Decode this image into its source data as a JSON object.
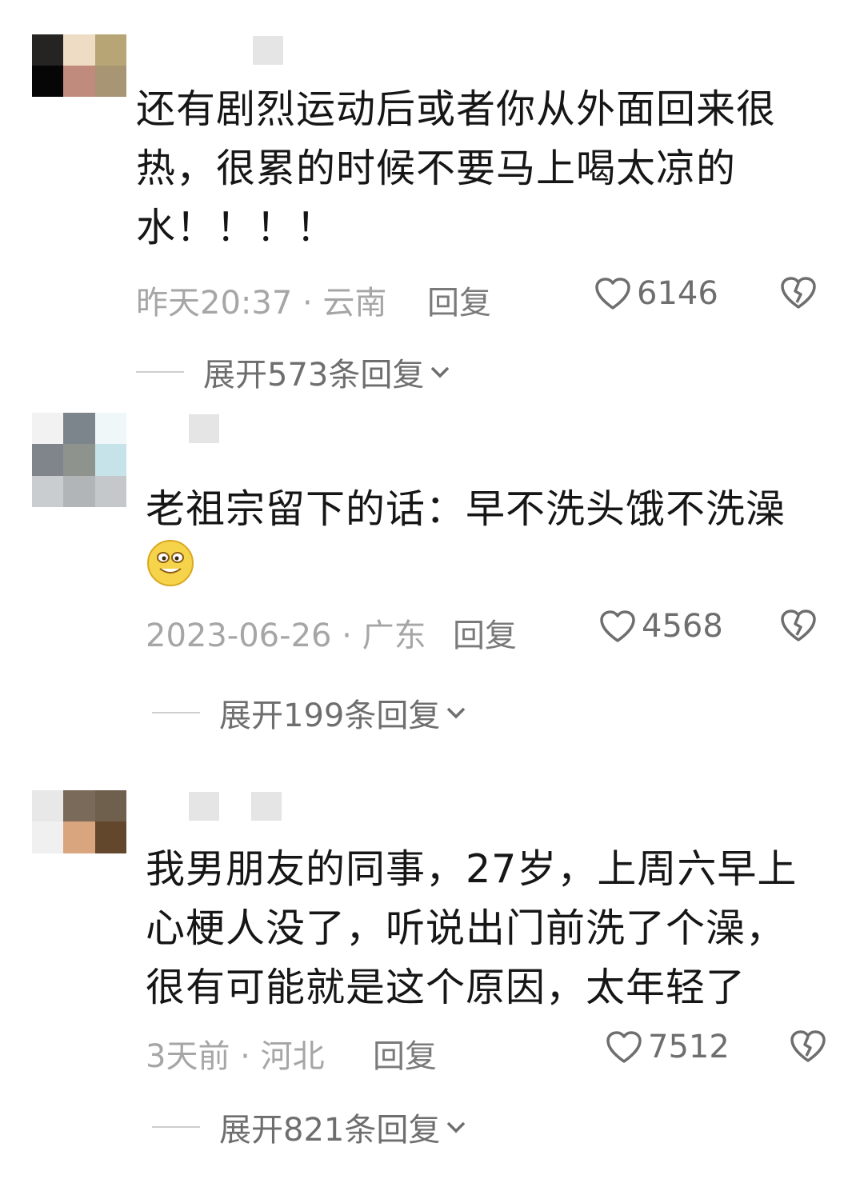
{
  "comments": [
    {
      "text_lines": [
        "还有剧烈运动后或者你从外面回来很",
        "热，很累的时候不要马上喝太凉的",
        "水！！！！"
      ],
      "time": "昨天20:37 · 云南",
      "reply_label": "回复",
      "likes": "6146",
      "expand_label": "展开573条回复"
    },
    {
      "text_lines": [
        "老祖宗留下的话：早不洗头饿不洗澡"
      ],
      "emoji": "grinning-emoji-icon",
      "time": "2023-06-26 · 广东",
      "reply_label": "回复",
      "likes": "4568",
      "expand_label": "展开199条回复"
    },
    {
      "text_lines": [
        "我男朋友的同事，27岁，上周六早上",
        "心梗人没了，听说出门前洗了个澡，",
        "很有可能就是这个原因，太年轻了"
      ],
      "time": "3天前 · 河北",
      "reply_label": "回复",
      "likes": "7512",
      "expand_label": "展开821条回复"
    }
  ],
  "icons": {
    "like": "heart-outline-icon",
    "dislike": "broken-heart-icon",
    "expand": "chevron-down-icon"
  },
  "colors": {
    "text": "#161616",
    "meta": "#a6a6a6",
    "action": "#6e6e6e"
  }
}
